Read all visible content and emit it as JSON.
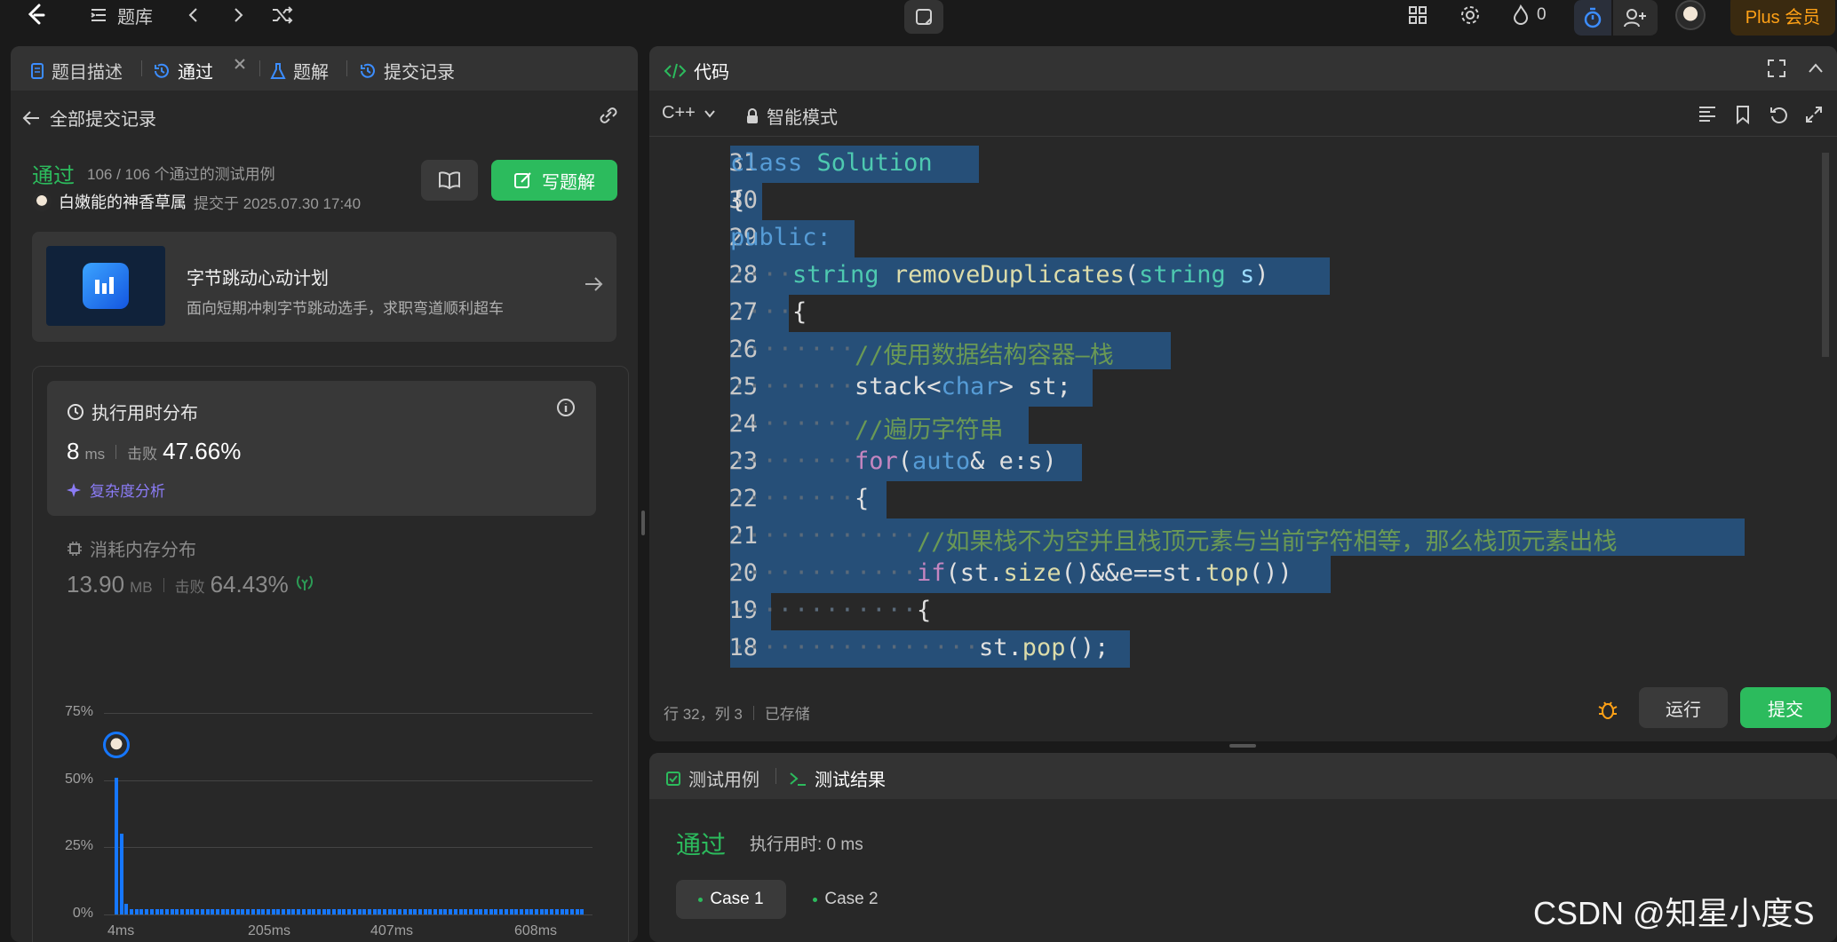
{
  "topbar": {
    "problem_bank": "题库",
    "streak_count": "0",
    "plus_label": "Plus 会员"
  },
  "left": {
    "tabs": [
      "题目描述",
      "通过",
      "题解",
      "提交记录"
    ],
    "back_label": "全部提交记录",
    "status": "通过",
    "test_summary": "106 / 106 个通过的测试用例",
    "user": "白嫩能的神香草属",
    "submitted_at": "提交于 2025.07.30 17:40",
    "write_solution": "写题解",
    "promo_title": "字节跳动心动计划",
    "promo_sub": "面向短期冲刺字节跳动选手，求职弯道顺利超车",
    "runtime_title": "执行用时分布",
    "runtime_value": "8",
    "runtime_unit": "ms",
    "beats_label": "击败",
    "runtime_beats": "47.66%",
    "complexity_label": "复杂度分析",
    "memory_title": "消耗内存分布",
    "memory_value": "13.90",
    "memory_unit": "MB",
    "memory_beats": "64.43%"
  },
  "chart_data": {
    "type": "bar",
    "y_ticks": [
      "75%",
      "50%",
      "25%",
      "0%"
    ],
    "x_ticks": [
      "4ms",
      "205ms",
      "407ms",
      "608ms"
    ],
    "ylim": [
      0,
      75
    ],
    "values": [
      51,
      30,
      4,
      2,
      2,
      2,
      2,
      2,
      2,
      2,
      2,
      2,
      2,
      2,
      2,
      2,
      2,
      2,
      2,
      2,
      2,
      2,
      2,
      2,
      2,
      2,
      2,
      2,
      2,
      2,
      2,
      2,
      2,
      2,
      2,
      2,
      2,
      2,
      2,
      2,
      2,
      2,
      2,
      2,
      2,
      2,
      2,
      2,
      2,
      2,
      2,
      2,
      2,
      2,
      2,
      2,
      2,
      2,
      2,
      2,
      2,
      2,
      2,
      2,
      2,
      2,
      2,
      2,
      2,
      2,
      2,
      2,
      2,
      2,
      2,
      2,
      2,
      2,
      2,
      2,
      2,
      2,
      2,
      2,
      2,
      2,
      2,
      2,
      2,
      2,
      2,
      2,
      2
    ],
    "highlight_index": 0
  },
  "code_panel": {
    "title": "代码",
    "language": "C++",
    "mode": "智能模式",
    "status_line": "行 32，列 3",
    "saved": "已存储",
    "run": "运行",
    "submit": "提交"
  },
  "code": [
    {
      "n": "31",
      "text": "class Solution"
    },
    {
      "n": "30",
      "text": "{"
    },
    {
      "n": "29",
      "text": "public:"
    },
    {
      "n": "28",
      "text": "string removeDuplicates(string s)"
    },
    {
      "n": "27",
      "text": "{"
    },
    {
      "n": "26",
      "text": "//使用数据结构容器—栈"
    },
    {
      "n": "25",
      "text": "stack<char> st;"
    },
    {
      "n": "24",
      "text": "//遍历字符串"
    },
    {
      "n": "23",
      "text": "for(auto& e:s)"
    },
    {
      "n": "22",
      "text": "{"
    },
    {
      "n": "21",
      "text": "//如果栈不为空并且栈顶元素与当前字符相等，那么栈顶元素出栈"
    },
    {
      "n": "20",
      "text": "if(st.size()&&e==st.top())"
    },
    {
      "n": "19",
      "text": "{"
    },
    {
      "n": "18",
      "text": "st.pop();"
    }
  ],
  "results": {
    "tab_cases": "测试用例",
    "tab_results": "测试结果",
    "status": "通过",
    "runtime": "执行用时: 0 ms",
    "cases": [
      "Case 1",
      "Case 2"
    ]
  },
  "watermark": "CSDN @知星小度S"
}
